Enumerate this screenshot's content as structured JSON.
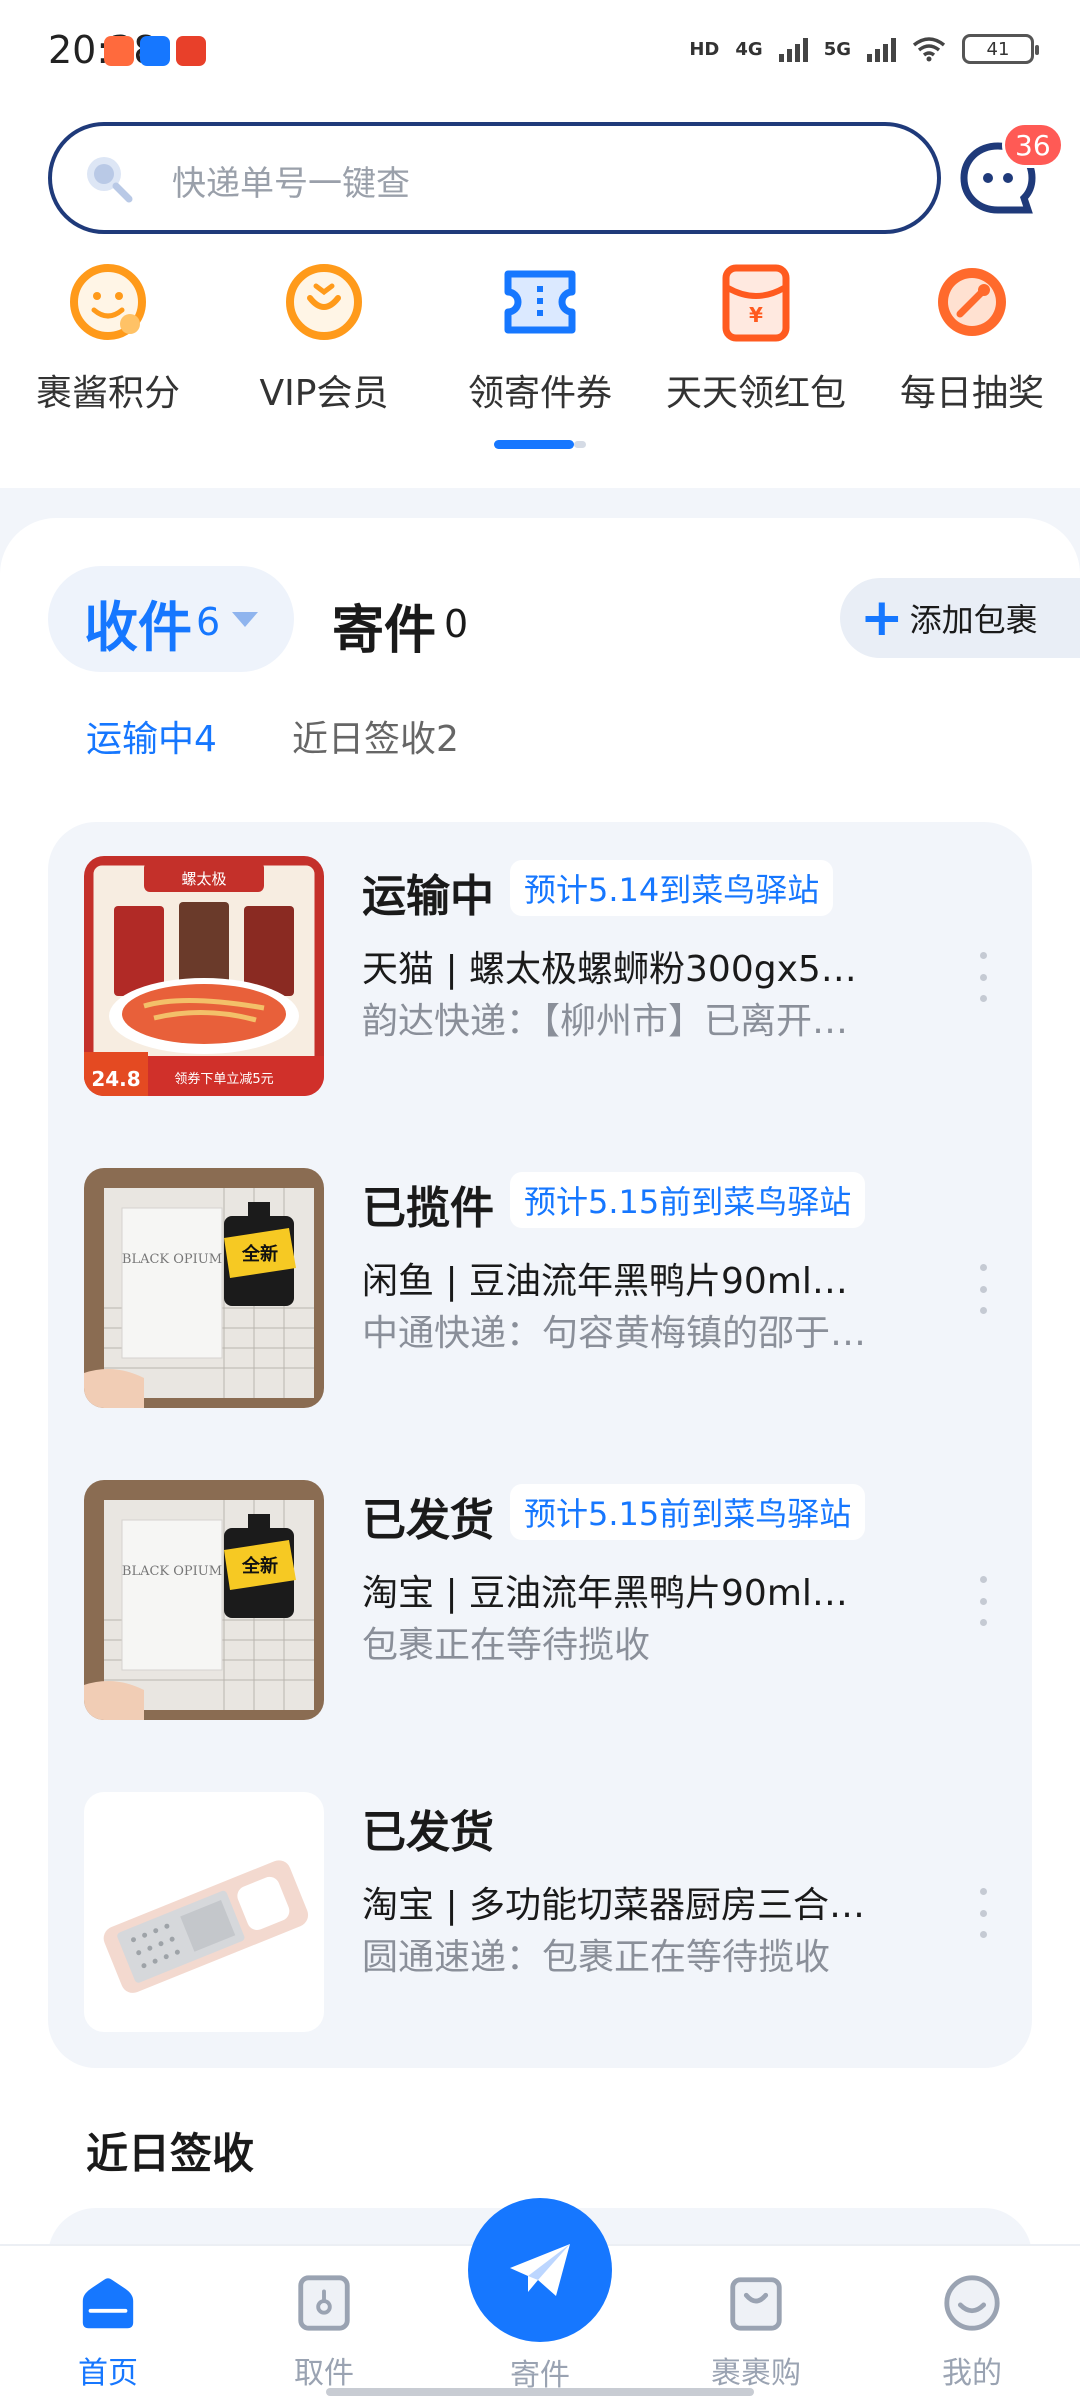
{
  "status_bar": {
    "time": "20:38",
    "indicators": [
      "HD",
      "4G",
      "5G"
    ],
    "battery": "41"
  },
  "search": {
    "placeholder": "快递单号一键查"
  },
  "messages": {
    "badge_count": "36"
  },
  "shortcuts": [
    {
      "label": "裹酱积分",
      "icon": "smiley-coin-icon",
      "color": "#ff9a1a"
    },
    {
      "label": "VIP会员",
      "icon": "vip-heart-icon",
      "color": "#ff9a1a"
    },
    {
      "label": "领寄件券",
      "icon": "coupon-icon",
      "color": "#1677ff"
    },
    {
      "label": "天天领红包",
      "icon": "red-envelope-icon",
      "color": "#ff5a1f"
    },
    {
      "label": "每日抽奖",
      "icon": "lottery-wheel-icon",
      "color": "#ff5a1f"
    }
  ],
  "tabs": {
    "receive_label": "收件",
    "receive_count": "6",
    "send_label": "寄件",
    "send_count": "0",
    "add_label": "添加包裹"
  },
  "sub_tabs": {
    "in_transit": "运输中4",
    "recent_signed": "近日签收2"
  },
  "packages": [
    {
      "status": "运输中",
      "eta": "预计5.14到菜鸟驿站",
      "title": "天猫 | 螺太极螺蛳粉300gx5…",
      "desc": "韵达快递：【柳州市】已离开…",
      "thumb": {
        "brand": "螺太极",
        "price": "24.8",
        "promo": "领券下单立减5元"
      }
    },
    {
      "status": "已揽件",
      "eta": "预计5.15前到菜鸟驿站",
      "title": "闲鱼 | 豆油流年黑鸭片90ml…",
      "desc": "中通快递：句容黄梅镇的邵于…",
      "thumb": {
        "brand": "BLACK OPIUM",
        "sticker": "全新"
      }
    },
    {
      "status": "已发货",
      "eta": "预计5.15前到菜鸟驿站",
      "title": "淘宝 | 豆油流年黑鸭片90ml…",
      "desc": "包裹正在等待揽收",
      "thumb": {
        "brand": "BLACK OPIUM",
        "sticker": "全新"
      }
    },
    {
      "status": "已发货",
      "eta": "",
      "title": "淘宝 | 多功能切菜器厨房三合…",
      "desc": "圆通速递：包裹正在等待揽收",
      "thumb": {}
    }
  ],
  "recent_section": {
    "title": "近日签收"
  },
  "bottom_nav": [
    {
      "label": "首页",
      "icon": "home-icon",
      "active": true
    },
    {
      "label": "取件",
      "icon": "pickup-box-icon",
      "active": false
    },
    {
      "label": "寄件",
      "icon": "paper-plane-icon",
      "active": false
    },
    {
      "label": "裹裹购",
      "icon": "shopping-bag-icon",
      "active": false
    },
    {
      "label": "我的",
      "icon": "profile-smile-icon",
      "active": false
    }
  ],
  "colors": {
    "accent": "#1677ff",
    "badge": "#ff5a55",
    "background": "#f2f5fa"
  }
}
